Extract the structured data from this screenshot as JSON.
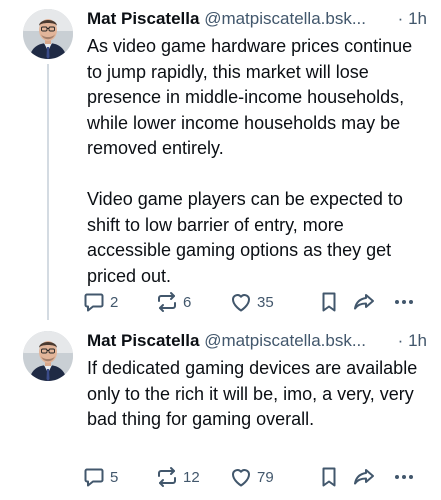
{
  "posts": [
    {
      "author_name": "Mat Piscatella",
      "author_handle": "@matpiscatella.bsk...",
      "separator": "·",
      "time": "1h",
      "text": "As video game hardware prices continue to jump rapidly, this market will lose presence in middle-income households, while lower income households may be removed entirely.\n\nVideo game players can be expected to shift to low barrier of entry, more accessible gaming options as they get priced out.",
      "reply_count": "2",
      "repost_count": "6",
      "like_count": "35",
      "has_thread_line": true
    },
    {
      "author_name": "Mat Piscatella",
      "author_handle": "@matpiscatella.bsk...",
      "separator": "·",
      "time": "1h",
      "text": "If dedicated gaming devices are available only to the rich it will be, imo, a very, very bad thing for gaming overall.",
      "reply_count": "5",
      "repost_count": "12",
      "like_count": "79",
      "has_thread_line": false
    }
  ],
  "icons": {
    "reply": "reply-bubble-icon",
    "repost": "repost-arrows-icon",
    "like": "heart-icon",
    "bookmark": "bookmark-icon",
    "share": "share-arrow-icon",
    "more": "more-dots-icon"
  },
  "colors": {
    "text": "#0b0f14",
    "muted": "#42576c",
    "thread_line": "#d4dbe2",
    "background": "#ffffff"
  }
}
